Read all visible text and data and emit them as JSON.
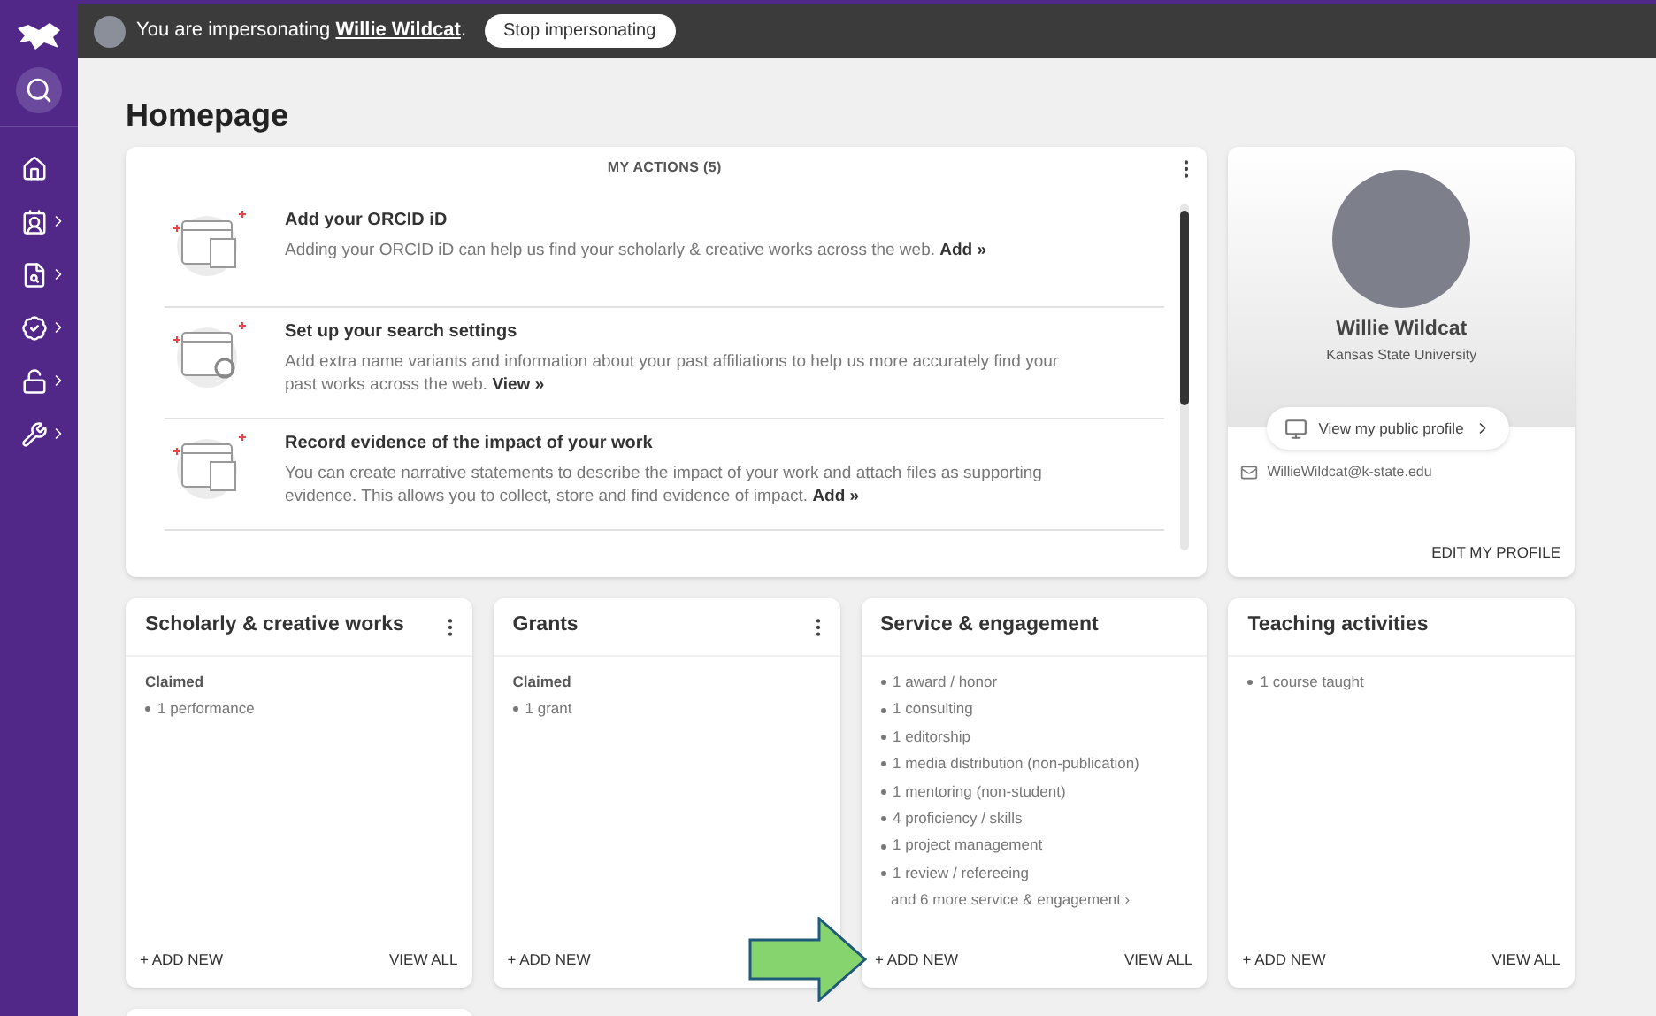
{
  "banner": {
    "prefix": "You are impersonating",
    "name": "Willie Wildcat",
    "suffix": ".",
    "button": "Stop impersonating"
  },
  "sidebar": {
    "items": [
      {
        "kind": "home",
        "has_submenu": false
      },
      {
        "kind": "profile",
        "has_submenu": true
      },
      {
        "kind": "search-doc",
        "has_submenu": true
      },
      {
        "kind": "badge-check",
        "has_submenu": true
      },
      {
        "kind": "open-access",
        "has_submenu": true
      },
      {
        "kind": "wrench",
        "has_submenu": true
      }
    ]
  },
  "page_title": "Homepage",
  "actions": {
    "title": "MY ACTIONS (5)",
    "items": [
      {
        "title": "Add your ORCID iD",
        "text": "Adding your ORCID iD can help us find your scholarly & creative works across the web.",
        "link": "Add »"
      },
      {
        "title": "Set up your search settings",
        "text": "Add extra name variants and information about your past affiliations to help us more accurately find your past works across the web.",
        "link": "View »"
      },
      {
        "title": "Record evidence of the impact of your work",
        "text": "You can create narrative statements to describe the impact of your work and attach files as supporting evidence. This allows you to collect, store and find evidence of impact.",
        "link": "Add »"
      }
    ]
  },
  "profile": {
    "name": "Willie Wildcat",
    "org": "Kansas State University",
    "public_profile": "View my public profile",
    "email": "WillieWildcat@k-state.edu",
    "edit": "EDIT MY PROFILE"
  },
  "cards": [
    {
      "title": "Scholarly & creative works",
      "menu": true,
      "heading": "Claimed",
      "items": [
        "1 performance"
      ],
      "add": "+ ADD NEW",
      "view": "VIEW ALL"
    },
    {
      "title": "Grants",
      "menu": true,
      "heading": "Claimed",
      "items": [
        "1 grant"
      ],
      "add": "+ ADD NEW"
    },
    {
      "title": "Service & engagement",
      "menu": false,
      "items": [
        "1 award / honor",
        "1 consulting",
        "1 editorship",
        "1 media distribution (non-publication)",
        "1 mentoring (non-student)",
        "4 proficiency / skills",
        "1 project management",
        "1 review / refereeing"
      ],
      "more": "and 6 more service & engagement ›",
      "add": "+ ADD NEW",
      "view": "VIEW ALL"
    },
    {
      "title": "Teaching activities",
      "menu": false,
      "items": [
        "1 course taught"
      ],
      "add": "+ ADD NEW",
      "view": "VIEW ALL"
    }
  ]
}
